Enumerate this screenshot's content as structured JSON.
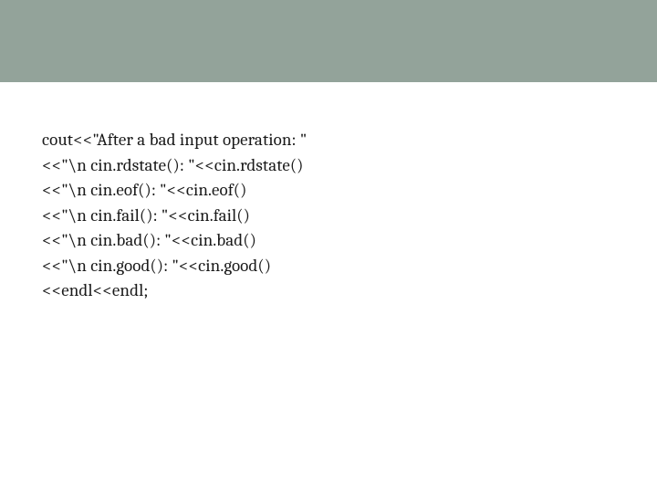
{
  "code": {
    "l0": "cout<<\"After a bad input operation: \"",
    "l1": "<<\"\\n cin.rdstate(): \"<<cin.rdstate()",
    "l2": "<<\"\\n cin.eof(): \"<<cin.eof()",
    "l3": "<<\"\\n cin.fail(): \"<<cin.fail()",
    "l4": "<<\"\\n cin.bad(): \"<<cin.bad()",
    "l5": "<<\"\\n cin.good(): \"<<cin.good()",
    "l6": "<<endl<<endl;"
  }
}
